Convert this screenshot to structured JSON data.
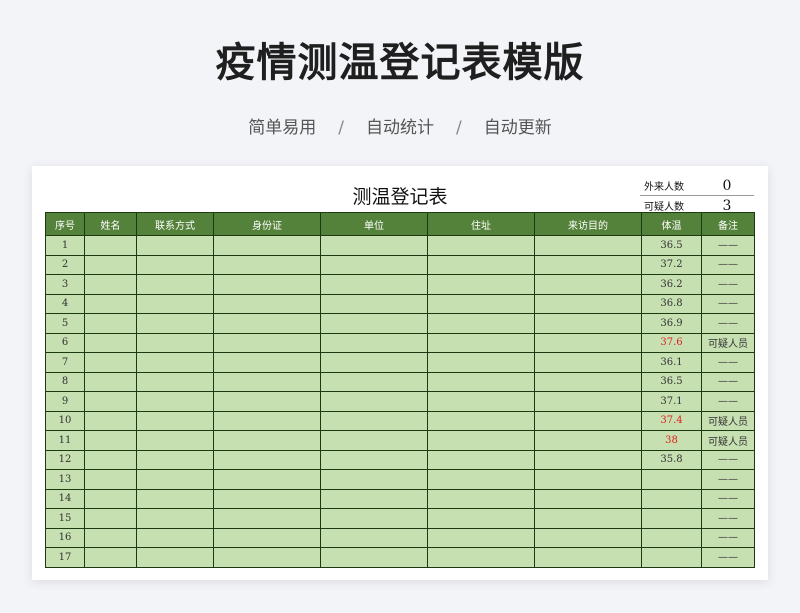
{
  "page": {
    "title": "疫情测温登记表模版",
    "features": [
      "简单易用",
      "自动统计",
      "自动更新"
    ],
    "separator": "/"
  },
  "sheet": {
    "title": "测温登记表",
    "summary": [
      {
        "label": "外来人数",
        "value": "0"
      },
      {
        "label": "可疑人数",
        "value": "3"
      }
    ],
    "columns": [
      "序号",
      "姓名",
      "联系方式",
      "身份证",
      "单位",
      "住址",
      "来访目的",
      "体温",
      "备注"
    ],
    "rows": [
      {
        "no": "1",
        "temp": "36.5",
        "note": "——",
        "suspect": false
      },
      {
        "no": "2",
        "temp": "37.2",
        "note": "——",
        "suspect": false
      },
      {
        "no": "3",
        "temp": "36.2",
        "note": "——",
        "suspect": false
      },
      {
        "no": "4",
        "temp": "36.8",
        "note": "——",
        "suspect": false
      },
      {
        "no": "5",
        "temp": "36.9",
        "note": "——",
        "suspect": false
      },
      {
        "no": "6",
        "temp": "37.6",
        "note": "可疑人员",
        "suspect": true
      },
      {
        "no": "7",
        "temp": "36.1",
        "note": "——",
        "suspect": false
      },
      {
        "no": "8",
        "temp": "36.5",
        "note": "——",
        "suspect": false
      },
      {
        "no": "9",
        "temp": "37.1",
        "note": "——",
        "suspect": false
      },
      {
        "no": "10",
        "temp": "37.4",
        "note": "可疑人员",
        "suspect": true
      },
      {
        "no": "11",
        "temp": "38",
        "note": "可疑人员",
        "suspect": true
      },
      {
        "no": "12",
        "temp": "35.8",
        "note": "——",
        "suspect": false
      },
      {
        "no": "13",
        "temp": "",
        "note": "——",
        "suspect": false
      },
      {
        "no": "14",
        "temp": "",
        "note": "——",
        "suspect": false
      },
      {
        "no": "15",
        "temp": "",
        "note": "——",
        "suspect": false
      },
      {
        "no": "16",
        "temp": "",
        "note": "——",
        "suspect": false
      },
      {
        "no": "17",
        "temp": "",
        "note": "——",
        "suspect": false
      }
    ],
    "colors": {
      "header_bg": "#54823a",
      "cell_bg": "#c7e0b2",
      "suspect_text": "#e21f1f"
    }
  }
}
